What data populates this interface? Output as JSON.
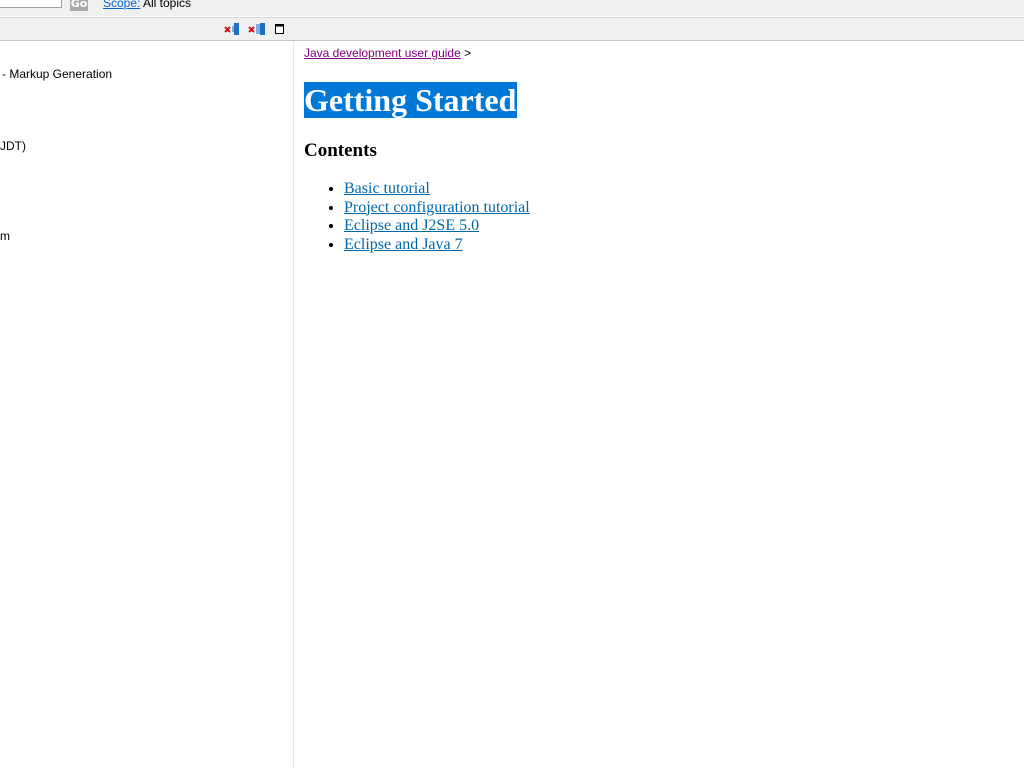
{
  "search": {
    "query": "",
    "go_label": "Go",
    "scope_label": "Scope:",
    "scope_value": "All topics"
  },
  "toolbar": {
    "icons": [
      "remove-bookmark-icon",
      "remove-all-bookmarks-icon",
      "maximize-icon"
    ]
  },
  "toc": {
    "items": [
      "- Markup Generation",
      "JDT)",
      "m"
    ]
  },
  "breadcrumb": {
    "link": "Java development user guide",
    "separator": ">"
  },
  "page": {
    "title": "Getting Started",
    "contents_heading": "Contents",
    "links": [
      "Basic tutorial",
      "Project configuration tutorial",
      "Eclipse and J2SE 5.0",
      "Eclipse and Java 7"
    ]
  },
  "colors": {
    "title_highlight": "#0078d7",
    "link": "#0066aa",
    "visited_link": "#800080",
    "toolbar_bg": "#f0f0f0"
  }
}
